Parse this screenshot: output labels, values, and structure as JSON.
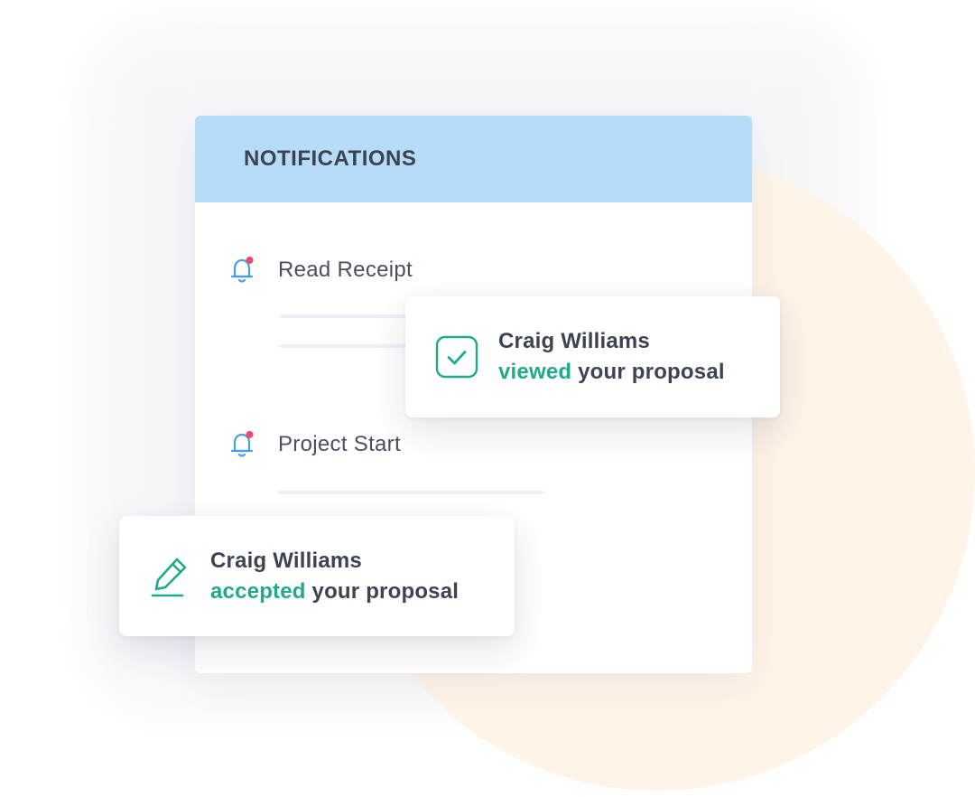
{
  "colors": {
    "header_bg": "#b7dcf8",
    "accent_green": "#20a98a",
    "bell_blue": "#4a9fe0",
    "bell_dot_red": "#ef4a63",
    "decor_circle": "#fef4e8"
  },
  "panel": {
    "title": "NOTIFICATIONS",
    "items": [
      {
        "label": "Read Receipt",
        "icon": "bell-icon"
      },
      {
        "label": "Project Start",
        "icon": "bell-icon"
      }
    ]
  },
  "toasts": [
    {
      "name": "Craig Williams",
      "verb": "viewed",
      "rest": " your proposal",
      "icon": "check-square-icon"
    },
    {
      "name": "Craig Williams",
      "verb": "accepted",
      "rest": " your proposal",
      "icon": "pencil-sign-icon"
    }
  ]
}
